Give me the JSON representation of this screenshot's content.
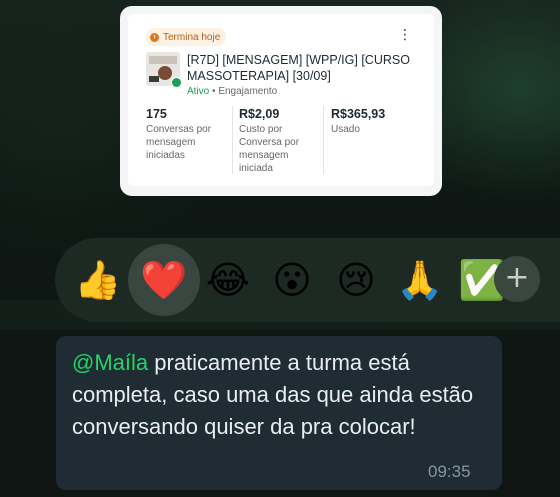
{
  "ad_card": {
    "badge": "Termina hoje",
    "title": "[R7D] [MENSAGEM] [WPP/IG] [CURSO MASSOTERAPIA] [30/09]",
    "status": "Ativo",
    "separator": "•",
    "objective": "Engajamento",
    "menu_icon": "more-vert-icon",
    "metrics": [
      {
        "value": "175",
        "label": "Conversas por mensagem iniciadas"
      },
      {
        "value": "R$2,09",
        "label": "Custo por Conversa por mensagem iniciada"
      },
      {
        "value": "R$365,93",
        "label": "Usado"
      }
    ]
  },
  "reactions": {
    "items": [
      {
        "emoji": "👍",
        "name": "thumbs-up"
      },
      {
        "emoji": "❤️",
        "name": "red-heart",
        "selected": true
      },
      {
        "emoji": "😂",
        "name": "tears-of-joy"
      },
      {
        "emoji": "😮",
        "name": "surprised"
      },
      {
        "emoji": "😢",
        "name": "crying"
      },
      {
        "emoji": "🙏",
        "name": "folded-hands"
      },
      {
        "emoji": "✅",
        "name": "check-mark"
      }
    ],
    "more_label": "+"
  },
  "message": {
    "mention": "@Maíla",
    "text": " praticamente a turma está completa, caso uma das que ainda estão conversando quiser da pra colocar!",
    "time": "09:35"
  },
  "colors": {
    "mention": "#25d366",
    "bubble": "#202c33",
    "active_status": "#1f9d55"
  }
}
